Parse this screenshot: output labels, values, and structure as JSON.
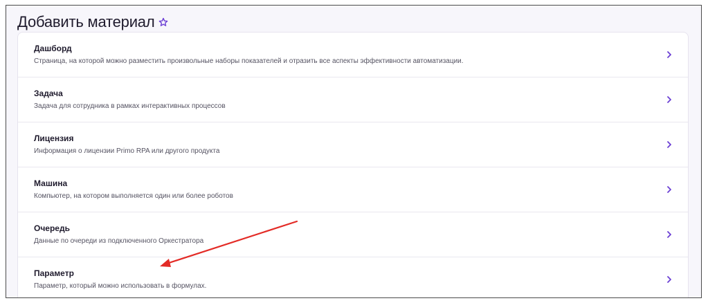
{
  "page": {
    "title": "Добавить материал"
  },
  "icons": {
    "title_star": "star-outline-icon",
    "chevron": "chevron-right-icon"
  },
  "colors": {
    "accent": "#6b3fd4",
    "annotation_arrow": "#e32b26",
    "text_primary": "#1f1b2d",
    "text_secondary": "#555362"
  },
  "items": [
    {
      "title": "Дашборд",
      "description": "Страница, на которой можно разместить произвольные наборы показателей и отразить все аспекты эффективности автоматизации."
    },
    {
      "title": "Задача",
      "description": "Задача для сотрудника в рамках интерактивных процессов"
    },
    {
      "title": "Лицензия",
      "description": "Информация о лицензии Primo RPA или другого продукта"
    },
    {
      "title": "Машина",
      "description": "Компьютер, на котором выполняется один или более роботов"
    },
    {
      "title": "Очередь",
      "description": "Данные по очереди из подключенного Оркестратора"
    },
    {
      "title": "Параметр",
      "description": "Параметр, который можно использовать в формулах."
    }
  ]
}
